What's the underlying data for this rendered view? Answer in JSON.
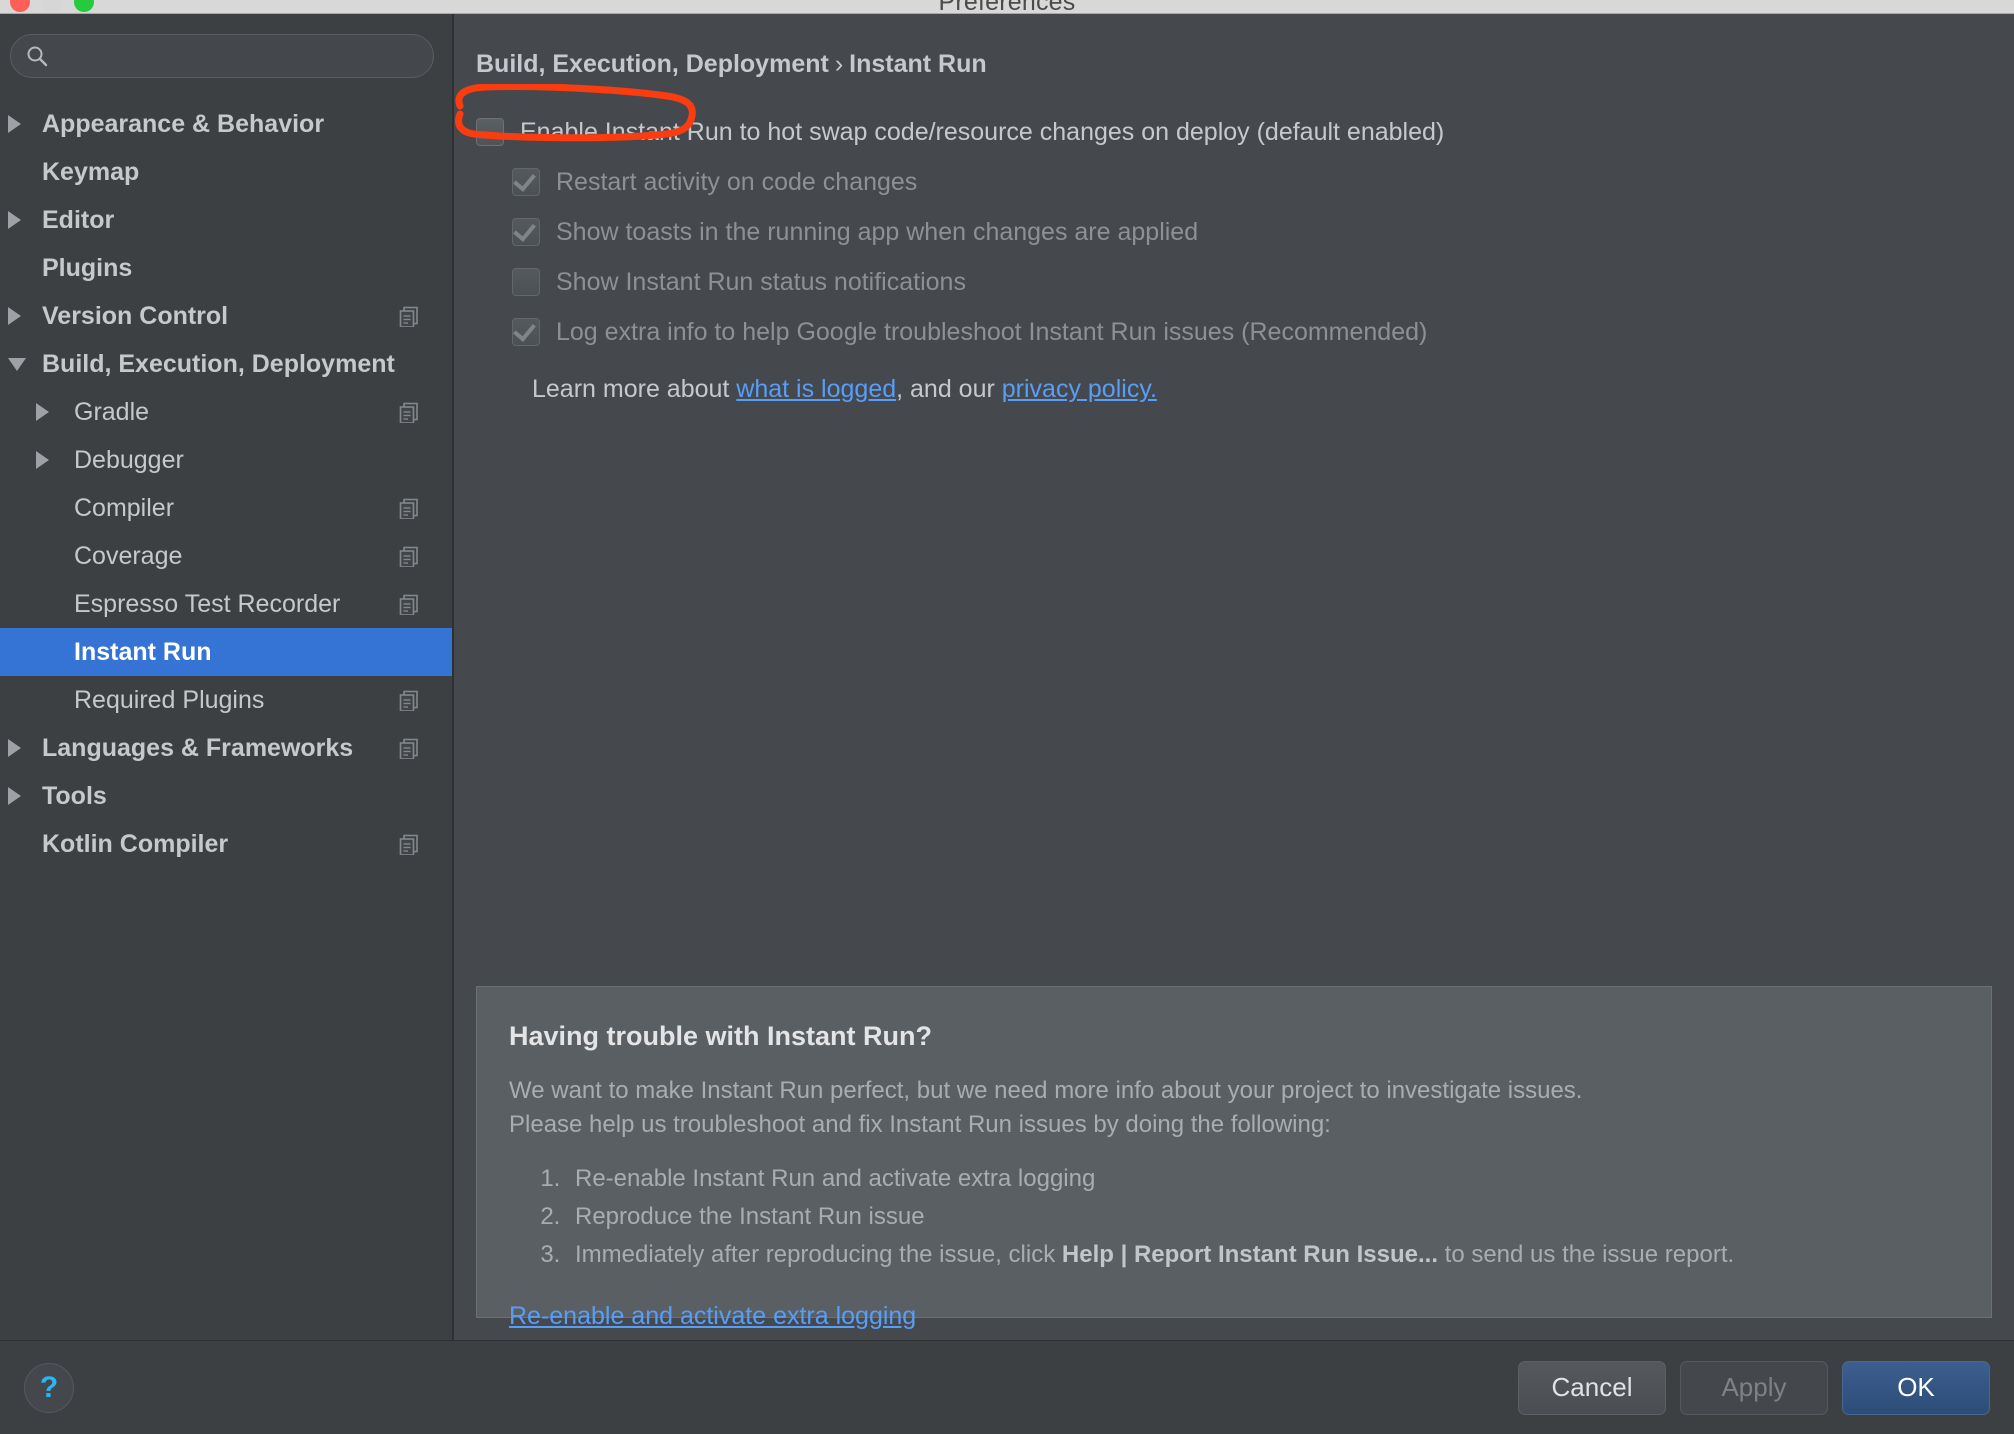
{
  "window": {
    "title": "Preferences",
    "traffic_lights": [
      "close",
      "minimize",
      "maximize"
    ]
  },
  "sidebar": {
    "search": {
      "value": "",
      "placeholder": ""
    },
    "items": [
      {
        "label": "Appearance & Behavior",
        "level": 0,
        "arrow": "collapsed",
        "copy_icon": false,
        "selected": false
      },
      {
        "label": "Keymap",
        "level": 0,
        "arrow": "none",
        "copy_icon": false,
        "selected": false
      },
      {
        "label": "Editor",
        "level": 0,
        "arrow": "collapsed",
        "copy_icon": false,
        "selected": false
      },
      {
        "label": "Plugins",
        "level": 0,
        "arrow": "none",
        "copy_icon": false,
        "selected": false
      },
      {
        "label": "Version Control",
        "level": 0,
        "arrow": "collapsed",
        "copy_icon": true,
        "selected": false
      },
      {
        "label": "Build, Execution, Deployment",
        "level": 0,
        "arrow": "expanded",
        "copy_icon": false,
        "selected": false
      },
      {
        "label": "Gradle",
        "level": 1,
        "arrow": "collapsed",
        "copy_icon": true,
        "selected": false
      },
      {
        "label": "Debugger",
        "level": 1,
        "arrow": "collapsed",
        "copy_icon": false,
        "selected": false
      },
      {
        "label": "Compiler",
        "level": 1,
        "arrow": "none",
        "copy_icon": true,
        "selected": false
      },
      {
        "label": "Coverage",
        "level": 1,
        "arrow": "none",
        "copy_icon": true,
        "selected": false
      },
      {
        "label": "Espresso Test Recorder",
        "level": 1,
        "arrow": "none",
        "copy_icon": true,
        "selected": false
      },
      {
        "label": "Instant Run",
        "level": 1,
        "arrow": "none",
        "copy_icon": false,
        "selected": true
      },
      {
        "label": "Required Plugins",
        "level": 1,
        "arrow": "none",
        "copy_icon": true,
        "selected": false
      },
      {
        "label": "Languages & Frameworks",
        "level": 0,
        "arrow": "collapsed",
        "copy_icon": true,
        "selected": false
      },
      {
        "label": "Tools",
        "level": 0,
        "arrow": "collapsed",
        "copy_icon": false,
        "selected": false
      },
      {
        "label": "Kotlin Compiler",
        "level": 0,
        "arrow": "none",
        "copy_icon": true,
        "selected": false
      }
    ]
  },
  "breadcrumb": {
    "parent": "Build, Execution, Deployment",
    "separator": "›",
    "current": "Instant Run"
  },
  "options": [
    {
      "label": "Enable Instant Run to hot swap code/resource changes on deploy (default enabled)",
      "checked": false,
      "enabled": true,
      "indent": false
    },
    {
      "label": "Restart activity on code changes",
      "checked": true,
      "enabled": false,
      "indent": true
    },
    {
      "label": "Show toasts in the running app when changes are applied",
      "checked": true,
      "enabled": false,
      "indent": true
    },
    {
      "label": "Show Instant Run status notifications",
      "checked": false,
      "enabled": false,
      "indent": true
    },
    {
      "label": "Log extra info to help Google troubleshoot Instant Run issues (Recommended)",
      "checked": true,
      "enabled": false,
      "indent": true
    }
  ],
  "learn_more": {
    "prefix": "Learn more about ",
    "link1": "what is logged",
    "middle": ", and our ",
    "link2": "privacy policy.",
    "suffix": ""
  },
  "trouble_panel": {
    "heading": "Having trouble with Instant Run?",
    "paragraph1": "We want to make Instant Run perfect, but we need more info about your project to investigate issues.",
    "paragraph2": "Please help us troubleshoot and fix Instant Run issues by doing the following:",
    "steps": [
      {
        "text": "Re-enable Instant Run and activate extra logging",
        "bold": "",
        "tail": ""
      },
      {
        "text": "Reproduce the Instant Run issue",
        "bold": "",
        "tail": ""
      },
      {
        "text": "Immediately after reproducing the issue, click ",
        "bold": "Help | Report Instant Run Issue...",
        "tail": " to send us the issue report."
      }
    ],
    "link": "Re-enable and activate extra logging"
  },
  "footer": {
    "help_glyph": "?",
    "cancel_label": "Cancel",
    "apply_label": "Apply",
    "ok_label": "OK"
  },
  "colors": {
    "selection_blue": "#3574d4",
    "link_blue": "#589df6",
    "default_button_blue": "#2d4c78",
    "help_icon_blue": "#29b6f6",
    "annotation_red": "#fa3c11",
    "sidebar_bg": "#3c4043",
    "content_bg": "#45494d",
    "panel_bg": "#5a5f63"
  },
  "annotation": {
    "shape": "hand-drawn-red-circle",
    "target": "Enable Instant Run checkbox"
  }
}
